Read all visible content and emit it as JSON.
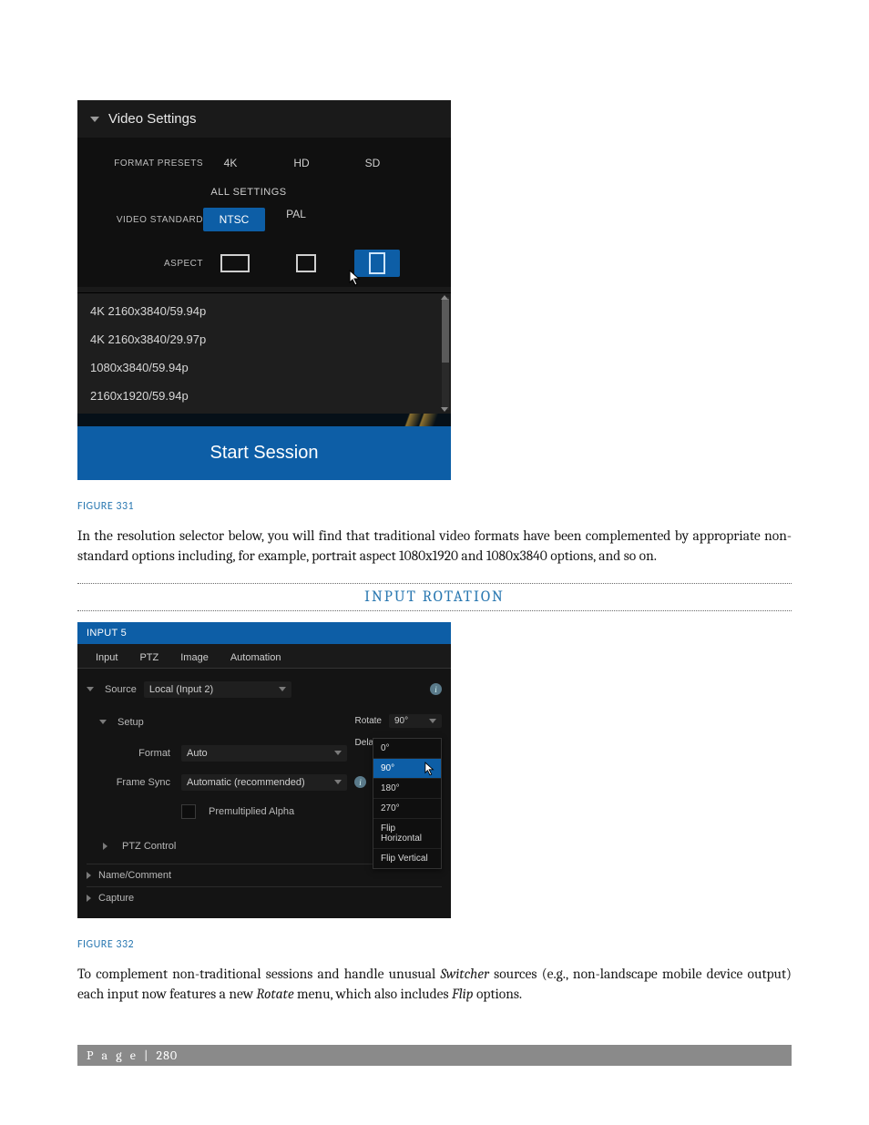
{
  "figure1": {
    "panelTitle": "Video Settings",
    "formatPresetsLabel": "FORMAT PRESETS",
    "presets": {
      "k4": "4K",
      "hd": "HD",
      "sd": "SD"
    },
    "allSettings": "ALL SETTINGS",
    "videoStandardLabel": "VIDEO STANDARD",
    "ntsc": "NTSC",
    "pal": "PAL",
    "aspectLabel": "ASPECT",
    "resolutions": [
      "4K 2160x3840/59.94p",
      "4K 2160x3840/29.97p",
      "1080x3840/59.94p",
      "2160x1920/59.94p"
    ],
    "startSession": "Start Session",
    "caption": "FIGURE 331"
  },
  "paragraph1": "In the resolution selector below, you will find that traditional video formats have been complemented by appropriate non-standard options including, for example, portrait aspect 1080x1920 and 1080x3840 options, and so on.",
  "sectionHeading": "INPUT ROTATION",
  "figure2": {
    "header": "INPUT 5",
    "tabs": {
      "input": "Input",
      "ptz": "PTZ",
      "image": "Image",
      "automation": "Automation"
    },
    "sourceLabel": "Source",
    "sourceValue": "Local (Input 2)",
    "setupLabel": "Setup",
    "formatLabel": "Format",
    "formatValue": "Auto",
    "frameSyncLabel": "Frame Sync",
    "frameSyncValue": "Automatic (recommended)",
    "premultipliedAlpha": "Premultiplied Alpha",
    "ptzControl": "PTZ Control",
    "nameComment": "Name/Comment",
    "capture": "Capture",
    "rotateLabel": "Rotate",
    "rotateSelected": "90°",
    "delayLabel": "Delay",
    "rotateOptions": {
      "o0": "0°",
      "o90": "90°",
      "o180": "180°",
      "o270": "270°",
      "flipH": "Flip Horizontal",
      "flipV": "Flip Vertical"
    },
    "caption": "FIGURE 332"
  },
  "paragraph2_pre": "To complement non-traditional sessions and handle unusual ",
  "paragraph2_switcher": "Switcher",
  "paragraph2_mid": " sources (e.g., non-landscape mobile device output) each input now features a new ",
  "paragraph2_rotate": "Rotate",
  "paragraph2_mid2": " menu, which also includes ",
  "paragraph2_flip": "Flip",
  "paragraph2_end": " options.",
  "footer": {
    "pageWord": "P a g e",
    "sep": "  |  ",
    "number": "280"
  }
}
